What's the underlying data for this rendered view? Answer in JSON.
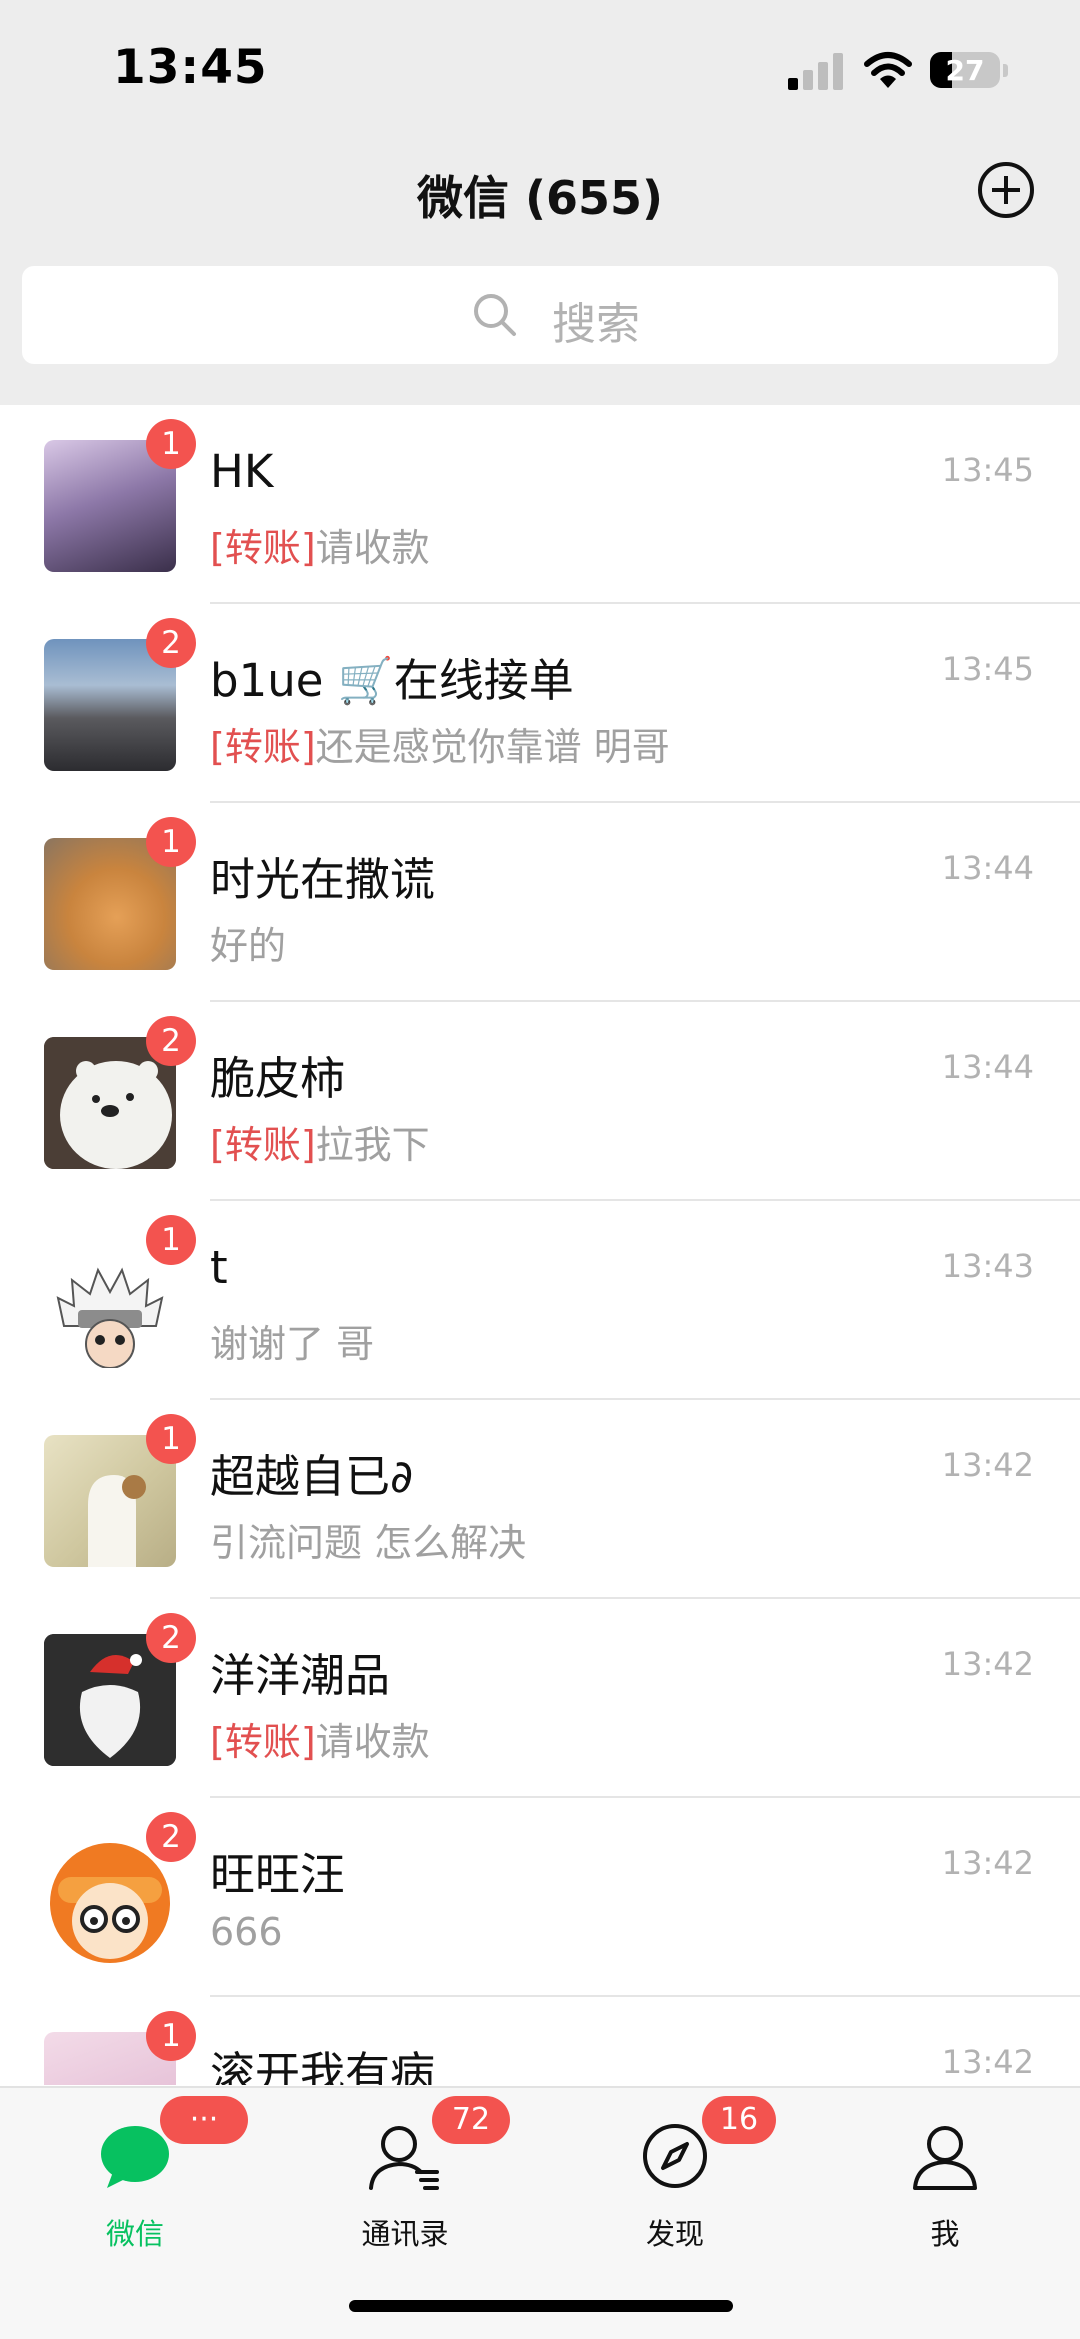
{
  "status_bar": {
    "time": "13:45",
    "battery": "27"
  },
  "header": {
    "title": "微信 (655)"
  },
  "search": {
    "placeholder": "搜索"
  },
  "chats": [
    {
      "name": "HK",
      "time": "13:45",
      "tag": "[转账]",
      "preview": "请收款",
      "badge": "1"
    },
    {
      "name": "b1ue 🛒在线接单",
      "time": "13:45",
      "tag": "[转账]",
      "preview": "还是感觉你靠谱 明哥",
      "badge": "2"
    },
    {
      "name": "时光在撒谎",
      "time": "13:44",
      "tag": "",
      "preview": "好的",
      "badge": "1"
    },
    {
      "name": "脆皮柿",
      "time": "13:44",
      "tag": "[转账]",
      "preview": "拉我下",
      "badge": "2"
    },
    {
      "name": "t",
      "time": "13:43",
      "tag": "",
      "preview": "谢谢了 哥",
      "badge": "1"
    },
    {
      "name": "超越自已∂",
      "time": "13:42",
      "tag": "",
      "preview": "引流问题 怎么解决",
      "badge": "1"
    },
    {
      "name": "洋洋潮品",
      "time": "13:42",
      "tag": "[转账]",
      "preview": "请收款",
      "badge": "2"
    },
    {
      "name": "旺旺汪",
      "time": "13:42",
      "tag": "",
      "preview": "666",
      "badge": "2"
    },
    {
      "name": "滚开我有病",
      "time": "13:42",
      "tag": "",
      "preview": "",
      "badge": "1"
    }
  ],
  "tabs": [
    {
      "label": "微信",
      "badge": "···",
      "icon": "chat-bubble-icon",
      "active": true
    },
    {
      "label": "通讯录",
      "badge": "72",
      "icon": "contacts-icon",
      "active": false
    },
    {
      "label": "发现",
      "badge": "16",
      "icon": "compass-icon",
      "active": false
    },
    {
      "label": "我",
      "badge": "",
      "icon": "person-icon",
      "active": false
    }
  ],
  "colors": {
    "accent": "#07c160",
    "badge": "#f3534f",
    "transfer_tag": "#e25050"
  }
}
